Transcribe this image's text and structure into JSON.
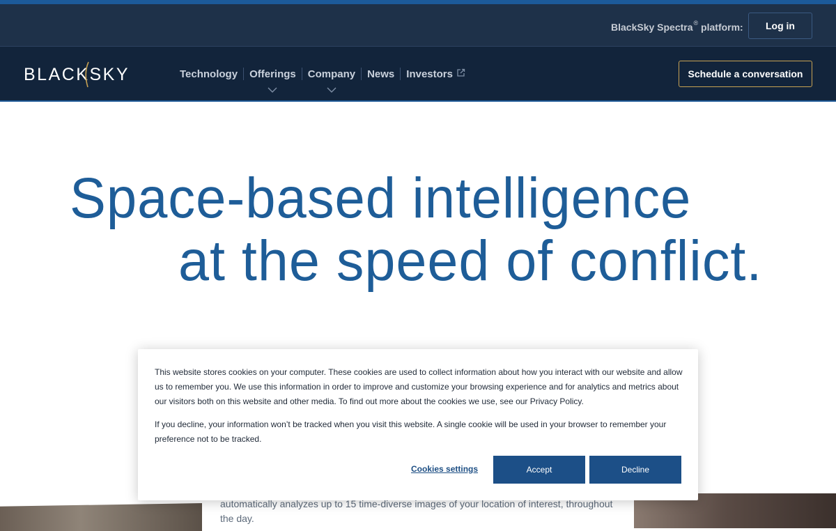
{
  "utility_bar": {
    "platform_label": "BlackSky Spectra",
    "platform_mark": "®",
    "platform_suffix": " platform:",
    "login_label": "Log in"
  },
  "nav": {
    "logo_text": "BLACKSKY",
    "items": [
      {
        "label": "Technology",
        "has_dropdown": false
      },
      {
        "label": "Offerings",
        "has_dropdown": true
      },
      {
        "label": "Company",
        "has_dropdown": true
      },
      {
        "label": "News",
        "has_dropdown": false
      },
      {
        "label": "Investors",
        "has_dropdown": false,
        "external": true
      }
    ],
    "cta_label": "Schedule a conversation",
    "icons": {
      "dropdown": "chevron-down-icon",
      "external": "external-link-icon"
    }
  },
  "hero": {
    "line1": "Space-based intelligence",
    "line2": "at the speed of conflict."
  },
  "background": {
    "partial_text": "automatically analyzes up to 15 time-diverse images of your location of interest, throughout the day."
  },
  "cookie_banner": {
    "paragraph1": "This website stores cookies on your computer. These cookies are used to collect information about how you interact with our website and allow us to remember you. We use this information in order to improve and customize your browsing experience and for analytics and metrics about our visitors both on this website and other media. To find out more about the cookies we use, see our Privacy Policy.",
    "paragraph2": "If you decline, your information won’t be tracked when you visit this website. A single cookie will be used in your browser to remember your preference not to be tracked.",
    "settings_label": "Cookies settings",
    "accept_label": "Accept",
    "decline_label": "Decline"
  },
  "colors": {
    "brand_blue": "#1e5d98",
    "nav_bg": "#12243b",
    "utility_bg": "#1e3149",
    "gold_accent": "#c8a253",
    "button_blue": "#1c4f87"
  }
}
